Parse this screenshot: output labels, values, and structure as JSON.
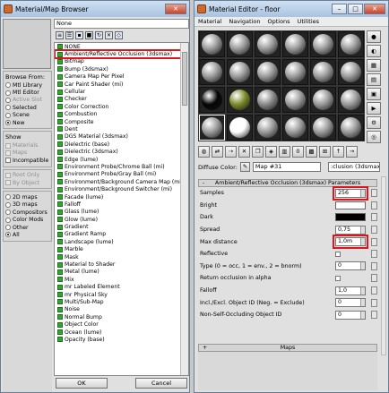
{
  "browser": {
    "title": "Material/Map Browser",
    "name_value": "None",
    "browse_from": {
      "title": "Browse From:",
      "options": [
        {
          "label": "Mtl Library",
          "on": false,
          "disabled": false
        },
        {
          "label": "Mtl Editor",
          "on": false,
          "disabled": false
        },
        {
          "label": "Active Slot",
          "on": false,
          "disabled": true
        },
        {
          "label": "Selected",
          "on": false,
          "disabled": false
        },
        {
          "label": "Scene",
          "on": false,
          "disabled": false
        },
        {
          "label": "New",
          "on": true,
          "disabled": false
        }
      ]
    },
    "show": {
      "title": "Show",
      "options": [
        {
          "label": "Materials",
          "disabled": true
        },
        {
          "label": "Maps",
          "disabled": true
        },
        {
          "label": "Incompatible",
          "disabled": false
        }
      ]
    },
    "root": [
      {
        "label": "Root Only"
      },
      {
        "label": "By Object"
      }
    ],
    "map_types": [
      {
        "label": "2D maps",
        "on": false
      },
      {
        "label": "3D maps",
        "on": false
      },
      {
        "label": "Compositors",
        "on": false
      },
      {
        "label": "Color Mods",
        "on": false
      },
      {
        "label": "Other",
        "on": false
      },
      {
        "label": "All",
        "on": true
      }
    ],
    "maps": [
      "NONE",
      "Ambient/Reflective Occlusion (3dsmax)",
      "Bitmap",
      "Bump (3dsmax)",
      "Camera Map Per Pixel",
      "Car Paint Shader (mi)",
      "Cellular",
      "Checker",
      "Color Correction",
      "Combustion",
      "Composite",
      "Dent",
      "DGS Material (3dsmax)",
      "Dielectric (base)",
      "Dielectric (3dsmax)",
      "Edge (lume)",
      "Environment Probe/Chrome Ball (mi)",
      "Environment Probe/Gray Ball (mi)",
      "Environment/Background Camera Map (mi)",
      "Environment/Background Switcher (mi)",
      "Facade (lume)",
      "Falloff",
      "Glass (lume)",
      "Glow (lume)",
      "Gradient",
      "Gradient Ramp",
      "Landscape (lume)",
      "Marble",
      "Mask",
      "Material to Shader",
      "Metal (lume)",
      "Mix",
      "mr Labeled Element",
      "mr Physical Sky",
      "Multi/Sub-Map",
      "Noise",
      "Normal Bump",
      "Object Color",
      "Ocean (lume)",
      "Opacity (base)"
    ],
    "ok_label": "OK",
    "cancel_label": "Cancel"
  },
  "editor": {
    "title": "Material Editor - floor",
    "menu": [
      "Material",
      "Navigation",
      "Options",
      "Utilities"
    ],
    "diffuse_label": "Diffuse Color:",
    "map_value": "Map #31",
    "map_type_value": ":clusion (3dsmax)",
    "rollout_title": "Ambient/Reflective Occlusion (3dsmax) Parameters",
    "rollout_sign": "-",
    "params": [
      {
        "label": "Samples",
        "value": "256",
        "kind": "spinner",
        "highlight": true
      },
      {
        "label": "Bright",
        "value": "",
        "kind": "swatch",
        "color": "#ffffff",
        "highlight": false
      },
      {
        "label": "Dark",
        "value": "",
        "kind": "swatch",
        "color": "#000000",
        "highlight": false
      },
      {
        "label": "Spread",
        "value": "0,75",
        "kind": "spinner",
        "highlight": false
      },
      {
        "label": "Max distance",
        "value": "1,0m",
        "kind": "spinner",
        "highlight": true
      },
      {
        "label": "Reflective",
        "value": "",
        "kind": "check",
        "highlight": false
      },
      {
        "label": "Type (0 = occ, 1 = env., 2 = bnorm)",
        "value": "0",
        "kind": "spinner",
        "highlight": false
      },
      {
        "label": "Return occlusion in alpha",
        "value": "",
        "kind": "check",
        "highlight": false
      },
      {
        "label": "Falloff",
        "value": "1,0",
        "kind": "spinner",
        "highlight": false
      },
      {
        "label": "Incl./Excl. Object ID (Neg. = Exclude)",
        "value": "0",
        "kind": "spinner",
        "highlight": false
      },
      {
        "label": "Non-Self-Occluding Object ID",
        "value": "0",
        "kind": "spinner",
        "highlight": false
      }
    ],
    "maps_rollout_title": "Maps",
    "maps_rollout_sign": "+",
    "slot_colors": [
      "#9a9a9a",
      "#9a9a9a",
      "#9a9a9a",
      "#9a9a9a",
      "#9a9a9a",
      "#9a9a9a",
      "#9a9a9a",
      "#9a9a9a",
      "#9a9a9a",
      "#9a9a9a",
      "#9a9a9a",
      "#9a9a9a",
      "#050505",
      "#7d8a2a",
      "#8a8a8a",
      "#9a9a9a",
      "#9a9a9a",
      "#9a9a9a",
      "#9a9a9a",
      "#ffffff",
      "#9a9a9a",
      "#9a9a9a",
      "#9a9a9a",
      "#9a9a9a"
    ]
  }
}
